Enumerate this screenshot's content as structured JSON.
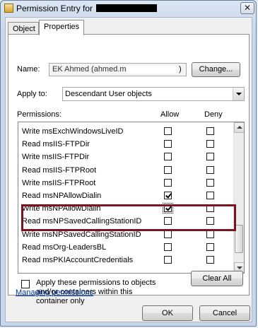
{
  "window": {
    "title": "Permission Entry for",
    "close_glyph": "✕"
  },
  "tabs": [
    {
      "label": "Object",
      "active": false
    },
    {
      "label": "Properties",
      "active": true
    }
  ],
  "name_field": {
    "label": "Name:",
    "value": "EK Ahmed (ahmed.malek@",
    "value_tail": ")",
    "button": "Change..."
  },
  "apply_to": {
    "label": "Apply to:",
    "selected": "Descendant User objects"
  },
  "permissions": {
    "label": "Permissions:",
    "allow_header": "Allow",
    "deny_header": "Deny",
    "rows": [
      {
        "label": "Write msExchWindowsLiveID",
        "allow": false,
        "deny": false
      },
      {
        "label": "Read msIIS-FTPDir",
        "allow": false,
        "deny": false
      },
      {
        "label": "Write msIIS-FTPDir",
        "allow": false,
        "deny": false
      },
      {
        "label": "Read msIIS-FTPRoot",
        "allow": false,
        "deny": false
      },
      {
        "label": "Write msIIS-FTPRoot",
        "allow": false,
        "deny": false
      },
      {
        "label": "Read msNPAllowDialin",
        "allow": true,
        "deny": false
      },
      {
        "label": "Write msNPAllowDialin",
        "allow": true,
        "deny": false
      },
      {
        "label": "Read msNPSavedCallingStationID",
        "allow": false,
        "deny": false
      },
      {
        "label": "Write msNPSavedCallingStationID",
        "allow": false,
        "deny": false
      },
      {
        "label": "Read msOrg-LeadersBL",
        "allow": false,
        "deny": false
      },
      {
        "label": "Read msPKIAccountCredentials",
        "allow": false,
        "deny": false
      }
    ]
  },
  "apply_inherit": {
    "checked": false,
    "text": "Apply these permissions to objects and/or containers within this container only"
  },
  "clear_all_button": "Clear All",
  "managing_link": "Managing permissions",
  "ok_button": "OK",
  "cancel_button": "Cancel",
  "colors": {
    "highlight_border": "#7b1320",
    "link": "#0033aa"
  }
}
